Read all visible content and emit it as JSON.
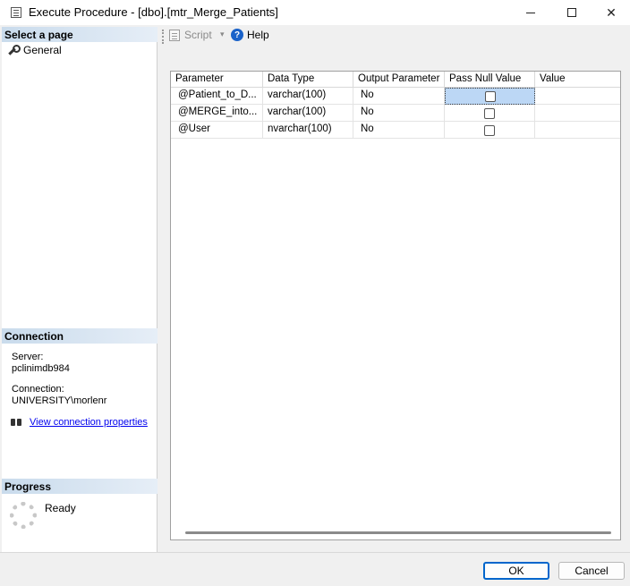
{
  "window": {
    "title": "Execute Procedure - [dbo].[mtr_Merge_Patients]",
    "close_glyph": "✕"
  },
  "left": {
    "select_page_header": "Select a page",
    "nav_items": [
      {
        "label": "General",
        "icon": "wrench-icon"
      }
    ],
    "connection_header": "Connection",
    "server_label": "Server:",
    "server_value": "pclinimdb984",
    "connection_label": "Connection:",
    "connection_value": "UNIVERSITY\\morlenr",
    "view_props_link": "View connection properties",
    "progress_header": "Progress",
    "progress_status": "Ready"
  },
  "toolbar": {
    "script_label": "Script",
    "script_dropdown": "▾",
    "help_label": "Help",
    "help_icon_glyph": "?"
  },
  "grid": {
    "columns": [
      "Parameter",
      "Data Type",
      "Output Parameter",
      "Pass Null Value",
      "Value"
    ],
    "rows": [
      {
        "parameter": "@Patient_to_D...",
        "data_type": "varchar(100)",
        "output": "No",
        "pass_null": false,
        "value": ""
      },
      {
        "parameter": "@MERGE_into...",
        "data_type": "varchar(100)",
        "output": "No",
        "pass_null": false,
        "value": ""
      },
      {
        "parameter": "@User",
        "data_type": "nvarchar(100)",
        "output": "No",
        "pass_null": false,
        "value": ""
      }
    ]
  },
  "buttons": {
    "ok": "OK",
    "cancel": "Cancel"
  },
  "colors": {
    "section_header": "#c9dbec",
    "selection": "#bcd7f5",
    "link": "#0000ee",
    "help_icon": "#1a62c9",
    "ok_border": "#0066cc"
  }
}
